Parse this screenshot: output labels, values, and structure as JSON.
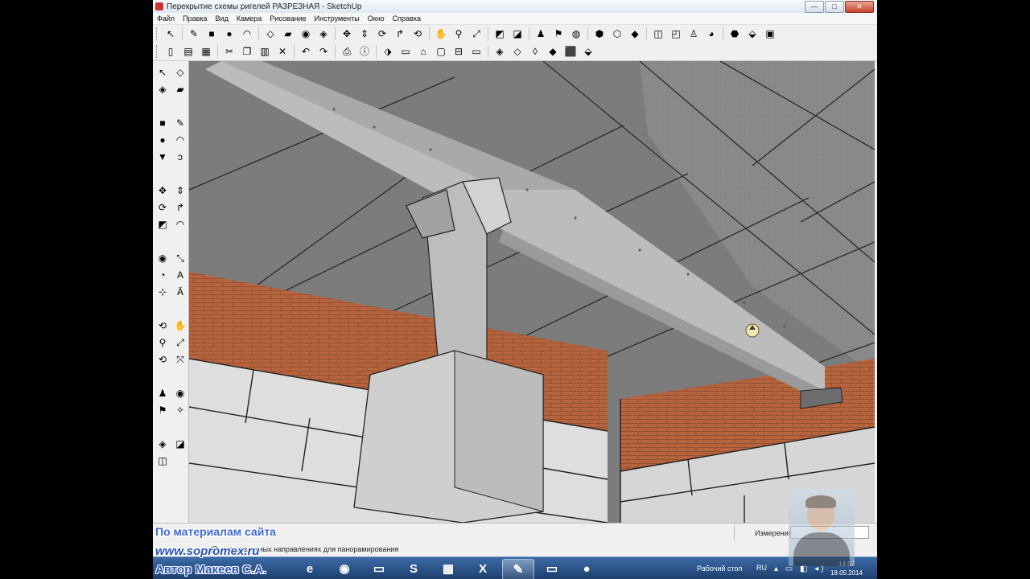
{
  "window": {
    "title": "Перекрытие схемы ригелей РАЗРЕЗНАЯ - SketchUp",
    "controls": [
      "—",
      "□",
      "✕"
    ]
  },
  "menu": [
    "Файл",
    "Правка",
    "Вид",
    "Камера",
    "Рисование",
    "Инструменты",
    "Окно",
    "Справка"
  ],
  "toolbar_row1": [
    {
      "icon": "select-arrow-icon",
      "glyph": "↖"
    },
    {
      "icon": "pencil-icon",
      "glyph": "✎"
    },
    {
      "icon": "rectangle-icon",
      "glyph": "■"
    },
    {
      "icon": "circle-icon",
      "glyph": "●"
    },
    {
      "icon": "arc-icon",
      "glyph": "◠"
    },
    {
      "icon": "make-component-icon",
      "glyph": "◇"
    },
    {
      "icon": "eraser-icon",
      "glyph": "▰"
    },
    {
      "icon": "tape-measure-icon",
      "glyph": "◉"
    },
    {
      "icon": "paint-bucket-icon",
      "glyph": "◈"
    },
    {
      "icon": "move-icon",
      "glyph": "✥"
    },
    {
      "icon": "push-pull-icon",
      "glyph": "⇕"
    },
    {
      "icon": "rotate-icon",
      "glyph": "⟳"
    },
    {
      "icon": "follow-me-icon",
      "glyph": "↱"
    },
    {
      "icon": "orbit-icon",
      "glyph": "⟲"
    },
    {
      "icon": "pan-hand-icon",
      "glyph": "✋"
    },
    {
      "icon": "zoom-icon",
      "glyph": "⚲"
    },
    {
      "icon": "zoom-extents-icon",
      "glyph": "⤢"
    },
    {
      "icon": "section-plane-icon",
      "glyph": "◩"
    },
    {
      "icon": "display-section-icon",
      "glyph": "◪"
    },
    {
      "icon": "position-camera-icon",
      "glyph": "♟"
    },
    {
      "icon": "walk-icon",
      "glyph": "⚑"
    },
    {
      "icon": "look-around-icon",
      "glyph": "◍"
    },
    {
      "icon": "get-models-icon",
      "glyph": "⬢"
    },
    {
      "icon": "share-model-icon",
      "glyph": "⬡"
    },
    {
      "icon": "component-icon",
      "glyph": "◆"
    },
    {
      "icon": "style-xray-icon",
      "glyph": "◫"
    },
    {
      "icon": "style-wireframe-icon",
      "glyph": "◰"
    },
    {
      "icon": "figure-icon",
      "glyph": "♙"
    },
    {
      "icon": "globe-icon",
      "glyph": "◕"
    },
    {
      "icon": "warehouse-icon",
      "glyph": "⬣"
    },
    {
      "icon": "extension-icon",
      "glyph": "⬙"
    },
    {
      "icon": "photo-texture-icon",
      "glyph": "▣"
    }
  ],
  "toolbar_row2": [
    {
      "icon": "new-file-icon",
      "glyph": "▯"
    },
    {
      "icon": "open-file-icon",
      "glyph": "▤"
    },
    {
      "icon": "save-icon",
      "glyph": "▦"
    },
    {
      "icon": "cut-icon",
      "glyph": "✂"
    },
    {
      "icon": "copy-icon",
      "glyph": "❐"
    },
    {
      "icon": "paste-icon",
      "glyph": "▥"
    },
    {
      "icon": "delete-icon",
      "glyph": "✕"
    },
    {
      "icon": "undo-icon",
      "glyph": "↶"
    },
    {
      "icon": "redo-icon",
      "glyph": "↷"
    },
    {
      "icon": "print-icon",
      "glyph": "⎙"
    },
    {
      "icon": "model-info-icon",
      "glyph": "ⓘ"
    },
    {
      "icon": "iso-view-icon",
      "glyph": "⬗"
    },
    {
      "icon": "top-view-icon",
      "glyph": "▭"
    },
    {
      "icon": "front-view-icon",
      "glyph": "⌂"
    },
    {
      "icon": "right-view-icon",
      "glyph": "▢"
    },
    {
      "icon": "back-view-icon",
      "glyph": "⊟"
    },
    {
      "icon": "left-view-icon",
      "glyph": "▭"
    },
    {
      "icon": "xray-face-icon",
      "glyph": "◈"
    },
    {
      "icon": "wireframe-face-icon",
      "glyph": "◇"
    },
    {
      "icon": "hidden-line-icon",
      "glyph": "◊"
    },
    {
      "icon": "shaded-icon",
      "glyph": "◆"
    },
    {
      "icon": "shaded-texture-icon",
      "glyph": "⬛"
    },
    {
      "icon": "monochrome-icon",
      "glyph": "⬙"
    }
  ],
  "left_tools": [
    {
      "icon": "select-icon",
      "glyph": "↖"
    },
    {
      "icon": "make-component-icon",
      "glyph": "◇"
    },
    {
      "icon": "paint-bucket-icon",
      "glyph": "◈"
    },
    {
      "icon": "eraser-icon",
      "glyph": "▰"
    },
    {
      "gap": true
    },
    {
      "icon": "rectangle-icon",
      "glyph": "■"
    },
    {
      "icon": "line-icon",
      "glyph": "✎"
    },
    {
      "icon": "circle-icon",
      "glyph": "●"
    },
    {
      "icon": "arc-icon",
      "glyph": "◠"
    },
    {
      "icon": "polygon-icon",
      "glyph": "▼"
    },
    {
      "icon": "freehand-icon",
      "glyph": "ↄ"
    },
    {
      "gap": true
    },
    {
      "icon": "move-icon",
      "glyph": "✥"
    },
    {
      "icon": "push-pull-icon",
      "glyph": "⇕"
    },
    {
      "icon": "rotate-icon",
      "glyph": "⟳"
    },
    {
      "icon": "follow-me-icon",
      "glyph": "↱"
    },
    {
      "icon": "scale-icon",
      "glyph": "◩"
    },
    {
      "icon": "offset-icon",
      "glyph": "◠"
    },
    {
      "gap": true
    },
    {
      "icon": "tape-measure-icon",
      "glyph": "◉"
    },
    {
      "icon": "dimension-icon",
      "glyph": "⤡"
    },
    {
      "icon": "protractor-icon",
      "glyph": "◔"
    },
    {
      "icon": "text-icon",
      "glyph": "A"
    },
    {
      "icon": "axes-icon",
      "glyph": "⊹"
    },
    {
      "icon": "3d-text-icon",
      "glyph": "Ä"
    },
    {
      "gap": true
    },
    {
      "icon": "orbit-icon",
      "glyph": "⟲"
    },
    {
      "icon": "pan-hand-icon",
      "glyph": "✋"
    },
    {
      "icon": "zoom-icon",
      "glyph": "⚲"
    },
    {
      "icon": "zoom-window-icon",
      "glyph": "⤢"
    },
    {
      "icon": "previous-view-icon",
      "glyph": "⟲"
    },
    {
      "icon": "zoom-extents-icon",
      "glyph": "⤧"
    },
    {
      "gap": true
    },
    {
      "icon": "position-camera-icon",
      "glyph": "♟"
    },
    {
      "icon": "look-around-icon",
      "glyph": "◉"
    },
    {
      "icon": "walk-icon",
      "glyph": "⚑"
    },
    {
      "icon": "axes-navigate-icon",
      "glyph": "✧"
    },
    {
      "gap": true
    },
    {
      "icon": "section-plane-icon",
      "glyph": "◈"
    },
    {
      "icon": "sandbox-icon",
      "glyph": "◪"
    },
    {
      "icon": "sandbox-smoove-icon",
      "glyph": "◫"
    }
  ],
  "status": {
    "measurements_label": "Измерения",
    "measurements_value": "",
    "hint": "...в различных направлениях для панорамирования"
  },
  "taskbar": {
    "apps": [
      {
        "icon": "ie-icon",
        "glyph": "e"
      },
      {
        "icon": "firefox-icon",
        "glyph": "◉"
      },
      {
        "icon": "explorer-folder-icon",
        "glyph": "▭"
      },
      {
        "icon": "skype-icon",
        "glyph": "S"
      },
      {
        "icon": "library-icon",
        "glyph": "▦"
      },
      {
        "icon": "excel-icon",
        "glyph": "X"
      },
      {
        "icon": "sketchup-icon",
        "glyph": "✎"
      },
      {
        "icon": "notes-icon",
        "glyph": "▭"
      },
      {
        "icon": "camera-recorder-icon",
        "glyph": "●"
      }
    ],
    "desktop_label": "Рабочий стол",
    "lang": "RU",
    "time": "14:57",
    "date": "18.05.2014"
  },
  "watermark": {
    "line1": "По материалам сайта",
    "line2": "www.sopromex.ru",
    "line3": "Автор Макеев С.А."
  },
  "colors": {
    "brick": "#b5643d",
    "ceiling": "#7c7c7c",
    "block": "#dedede",
    "beam": "#b9b9b9"
  }
}
